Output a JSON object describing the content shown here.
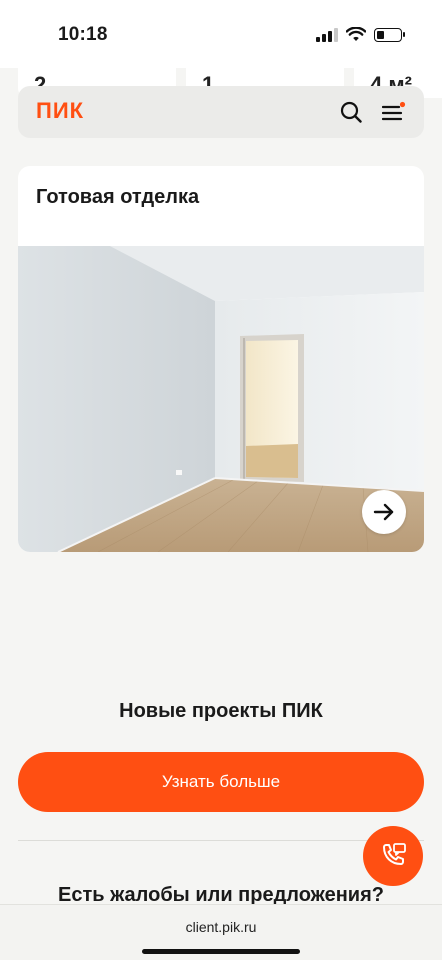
{
  "status_bar": {
    "time": "10:18",
    "battery_level_percent": 30
  },
  "peek_cards": [
    "2",
    "1",
    "4 м²"
  ],
  "header": {
    "logo": "ПИК"
  },
  "card": {
    "title": "Готовая отделка"
  },
  "new_projects": {
    "title": "Новые проекты ПИК",
    "cta_label": "Узнать больше"
  },
  "feedback": {
    "title": "Есть жалобы или предложения?"
  },
  "browser": {
    "url": "client.pik.ru"
  },
  "colors": {
    "brand": "#ff4f12",
    "background": "#f5f5f3",
    "header_bg": "#ebebe9"
  }
}
